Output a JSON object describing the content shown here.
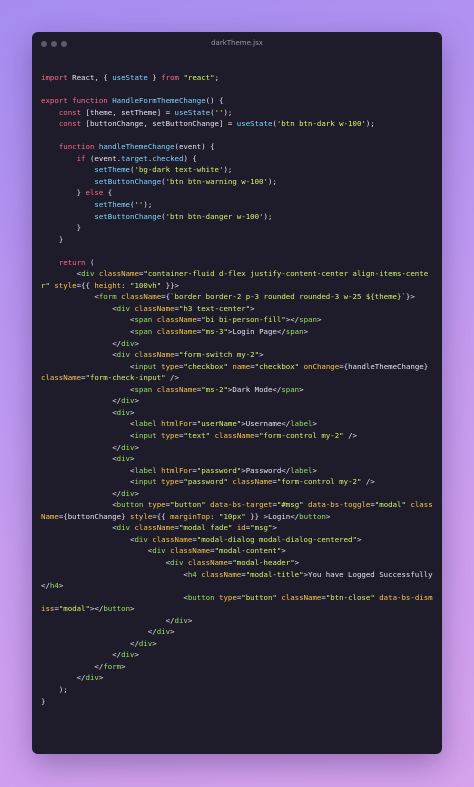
{
  "window": {
    "title": "darkTheme.jsx"
  },
  "colors": {
    "keyword": "#ff6b88",
    "function": "#7fd7ff",
    "tag": "#9de05d",
    "attribute": "#f6c94c",
    "string": "#d4f46a",
    "text": "#e6e3ee"
  },
  "code_lines": [
    [
      [
        "kw",
        "import"
      ],
      [
        "p",
        " React, { "
      ],
      [
        "fn",
        "useState"
      ],
      [
        "p",
        " } "
      ],
      [
        "kw",
        "from"
      ],
      [
        "p",
        " "
      ],
      [
        "str",
        "\"react\""
      ],
      [
        "p",
        ";"
      ]
    ],
    [],
    [
      [
        "kw",
        "export function"
      ],
      [
        "p",
        " "
      ],
      [
        "fn",
        "HandleFormThemeChange"
      ],
      [
        "p",
        "() {"
      ]
    ],
    [
      [
        "p",
        "    "
      ],
      [
        "kw",
        "const"
      ],
      [
        "p",
        " [theme, setTheme] = "
      ],
      [
        "fn",
        "useState"
      ],
      [
        "p",
        "("
      ],
      [
        "str",
        "''"
      ],
      [
        "p",
        ");"
      ]
    ],
    [
      [
        "p",
        "    "
      ],
      [
        "kw",
        "const"
      ],
      [
        "p",
        " [buttonChange, setButtonChange] = "
      ],
      [
        "fn",
        "useState"
      ],
      [
        "p",
        "("
      ],
      [
        "str",
        "'btn btn-dark w-100'"
      ],
      [
        "p",
        ");"
      ]
    ],
    [],
    [
      [
        "p",
        "    "
      ],
      [
        "kw",
        "function"
      ],
      [
        "p",
        " "
      ],
      [
        "fn",
        "handleThemeChange"
      ],
      [
        "p",
        "(event) {"
      ]
    ],
    [
      [
        "p",
        "        "
      ],
      [
        "kw",
        "if"
      ],
      [
        "p",
        " (event."
      ],
      [
        "fn",
        "target"
      ],
      [
        "p",
        "."
      ],
      [
        "fn",
        "checked"
      ],
      [
        "p",
        ") {"
      ]
    ],
    [
      [
        "p",
        "            "
      ],
      [
        "fn",
        "setTheme"
      ],
      [
        "p",
        "("
      ],
      [
        "str",
        "'bg-dark text-white'"
      ],
      [
        "p",
        ");"
      ]
    ],
    [
      [
        "p",
        "            "
      ],
      [
        "fn",
        "setButtonChange"
      ],
      [
        "p",
        "("
      ],
      [
        "str",
        "'btn btn-warning w-100'"
      ],
      [
        "p",
        ");"
      ]
    ],
    [
      [
        "p",
        "        } "
      ],
      [
        "kw",
        "else"
      ],
      [
        "p",
        " {"
      ]
    ],
    [
      [
        "p",
        "            "
      ],
      [
        "fn",
        "setTheme"
      ],
      [
        "p",
        "("
      ],
      [
        "str",
        "''"
      ],
      [
        "p",
        ");"
      ]
    ],
    [
      [
        "p",
        "            "
      ],
      [
        "fn",
        "setButtonChange"
      ],
      [
        "p",
        "("
      ],
      [
        "str",
        "'btn btn-danger w-100'"
      ],
      [
        "p",
        ");"
      ]
    ],
    [
      [
        "p",
        "        }"
      ]
    ],
    [
      [
        "p",
        "    }"
      ]
    ],
    [],
    [
      [
        "p",
        "    "
      ],
      [
        "kw",
        "return"
      ],
      [
        "p",
        " ("
      ]
    ],
    [
      [
        "p",
        "        <"
      ],
      [
        "tag",
        "div"
      ],
      [
        "p",
        " "
      ],
      [
        "attr",
        "className"
      ],
      [
        "p",
        "="
      ],
      [
        "str",
        "\"container-fluid d-flex justify-content-center align-items-center\""
      ],
      [
        "p",
        " "
      ],
      [
        "attr",
        "style"
      ],
      [
        "p",
        "={{ "
      ],
      [
        "attr",
        "height"
      ],
      [
        "p",
        ": "
      ],
      [
        "str",
        "\"100vh\""
      ],
      [
        "p",
        " }}>"
      ]
    ],
    [
      [
        "p",
        "            <"
      ],
      [
        "tag",
        "form"
      ],
      [
        "p",
        " "
      ],
      [
        "attr",
        "className"
      ],
      [
        "p",
        "={"
      ],
      [
        "str",
        "`border border-2 p-3 rounded rounded-3 w-25 ${theme}`"
      ],
      [
        "p",
        "}>"
      ]
    ],
    [
      [
        "p",
        "                <"
      ],
      [
        "tag",
        "div"
      ],
      [
        "p",
        " "
      ],
      [
        "attr",
        "className"
      ],
      [
        "p",
        "="
      ],
      [
        "str",
        "\"h3 text-center\""
      ],
      [
        "p",
        ">"
      ]
    ],
    [
      [
        "p",
        "                    <"
      ],
      [
        "tag",
        "span"
      ],
      [
        "p",
        " "
      ],
      [
        "attr",
        "className"
      ],
      [
        "p",
        "="
      ],
      [
        "str",
        "\"bi bi-person-fill\""
      ],
      [
        "p",
        "></"
      ],
      [
        "tag",
        "span"
      ],
      [
        "p",
        ">"
      ]
    ],
    [
      [
        "p",
        "                    <"
      ],
      [
        "tag",
        "span"
      ],
      [
        "p",
        " "
      ],
      [
        "attr",
        "className"
      ],
      [
        "p",
        "="
      ],
      [
        "str",
        "\"ms-3\""
      ],
      [
        "p",
        ">Login Page</"
      ],
      [
        "tag",
        "span"
      ],
      [
        "p",
        ">"
      ]
    ],
    [
      [
        "p",
        "                </"
      ],
      [
        "tag",
        "div"
      ],
      [
        "p",
        ">"
      ]
    ],
    [
      [
        "p",
        "                <"
      ],
      [
        "tag",
        "div"
      ],
      [
        "p",
        " "
      ],
      [
        "attr",
        "className"
      ],
      [
        "p",
        "="
      ],
      [
        "str",
        "\"form-switch my-2\""
      ],
      [
        "p",
        ">"
      ]
    ],
    [
      [
        "p",
        "                    <"
      ],
      [
        "tag",
        "input"
      ],
      [
        "p",
        " "
      ],
      [
        "attr",
        "type"
      ],
      [
        "p",
        "="
      ],
      [
        "str",
        "\"checkbox\""
      ],
      [
        "p",
        " "
      ],
      [
        "attr",
        "name"
      ],
      [
        "p",
        "="
      ],
      [
        "str",
        "\"checkbox\""
      ],
      [
        "p",
        " "
      ],
      [
        "attr",
        "onChange"
      ],
      [
        "p",
        "={handleThemeChange} "
      ],
      [
        "attr",
        "className"
      ],
      [
        "p",
        "="
      ],
      [
        "str",
        "\"form-check-input\""
      ],
      [
        "p",
        " />"
      ]
    ],
    [
      [
        "p",
        "                    <"
      ],
      [
        "tag",
        "span"
      ],
      [
        "p",
        " "
      ],
      [
        "attr",
        "className"
      ],
      [
        "p",
        "="
      ],
      [
        "str",
        "\"ms-2\""
      ],
      [
        "p",
        ">Dark Mode</"
      ],
      [
        "tag",
        "span"
      ],
      [
        "p",
        ">"
      ]
    ],
    [
      [
        "p",
        "                </"
      ],
      [
        "tag",
        "div"
      ],
      [
        "p",
        ">"
      ]
    ],
    [
      [
        "p",
        "                <"
      ],
      [
        "tag",
        "div"
      ],
      [
        "p",
        ">"
      ]
    ],
    [
      [
        "p",
        "                    <"
      ],
      [
        "tag",
        "label"
      ],
      [
        "p",
        " "
      ],
      [
        "attr",
        "htmlFor"
      ],
      [
        "p",
        "="
      ],
      [
        "str",
        "\"userName\""
      ],
      [
        "p",
        ">Username</"
      ],
      [
        "tag",
        "label"
      ],
      [
        "p",
        ">"
      ]
    ],
    [
      [
        "p",
        "                    <"
      ],
      [
        "tag",
        "input"
      ],
      [
        "p",
        " "
      ],
      [
        "attr",
        "type"
      ],
      [
        "p",
        "="
      ],
      [
        "str",
        "\"text\""
      ],
      [
        "p",
        " "
      ],
      [
        "attr",
        "className"
      ],
      [
        "p",
        "="
      ],
      [
        "str",
        "\"form-control my-2\""
      ],
      [
        "p",
        " />"
      ]
    ],
    [
      [
        "p",
        "                </"
      ],
      [
        "tag",
        "div"
      ],
      [
        "p",
        ">"
      ]
    ],
    [
      [
        "p",
        "                <"
      ],
      [
        "tag",
        "div"
      ],
      [
        "p",
        ">"
      ]
    ],
    [
      [
        "p",
        "                    <"
      ],
      [
        "tag",
        "label"
      ],
      [
        "p",
        " "
      ],
      [
        "attr",
        "htmlFor"
      ],
      [
        "p",
        "="
      ],
      [
        "str",
        "\"password\""
      ],
      [
        "p",
        ">Password</"
      ],
      [
        "tag",
        "label"
      ],
      [
        "p",
        ">"
      ]
    ],
    [
      [
        "p",
        "                    <"
      ],
      [
        "tag",
        "input"
      ],
      [
        "p",
        " "
      ],
      [
        "attr",
        "type"
      ],
      [
        "p",
        "="
      ],
      [
        "str",
        "\"password\""
      ],
      [
        "p",
        " "
      ],
      [
        "attr",
        "className"
      ],
      [
        "p",
        "="
      ],
      [
        "str",
        "\"form-control my-2\""
      ],
      [
        "p",
        " />"
      ]
    ],
    [
      [
        "p",
        "                </"
      ],
      [
        "tag",
        "div"
      ],
      [
        "p",
        ">"
      ]
    ],
    [
      [
        "p",
        "                <"
      ],
      [
        "tag",
        "button"
      ],
      [
        "p",
        " "
      ],
      [
        "attr",
        "type"
      ],
      [
        "p",
        "="
      ],
      [
        "str",
        "\"button\""
      ],
      [
        "p",
        " "
      ],
      [
        "attr",
        "data-bs-target"
      ],
      [
        "p",
        "="
      ],
      [
        "str",
        "\"#msg\""
      ],
      [
        "p",
        " "
      ],
      [
        "attr",
        "data-bs-toggle"
      ],
      [
        "p",
        "="
      ],
      [
        "str",
        "\"modal\""
      ],
      [
        "p",
        " "
      ],
      [
        "attr",
        "className"
      ],
      [
        "p",
        "={buttonChange} "
      ],
      [
        "attr",
        "style"
      ],
      [
        "p",
        "={{ "
      ],
      [
        "attr",
        "marginTop"
      ],
      [
        "p",
        ": "
      ],
      [
        "str",
        "\"10px\""
      ],
      [
        "p",
        " }} >Login</"
      ],
      [
        "tag",
        "button"
      ],
      [
        "p",
        ">"
      ]
    ],
    [
      [
        "p",
        "                <"
      ],
      [
        "tag",
        "div"
      ],
      [
        "p",
        " "
      ],
      [
        "attr",
        "className"
      ],
      [
        "p",
        "="
      ],
      [
        "str",
        "\"modal fade\""
      ],
      [
        "p",
        " "
      ],
      [
        "attr",
        "id"
      ],
      [
        "p",
        "="
      ],
      [
        "str",
        "\"msg\""
      ],
      [
        "p",
        ">"
      ]
    ],
    [
      [
        "p",
        "                    <"
      ],
      [
        "tag",
        "div"
      ],
      [
        "p",
        " "
      ],
      [
        "attr",
        "className"
      ],
      [
        "p",
        "="
      ],
      [
        "str",
        "\"modal-dialog modal-dialog-centered\""
      ],
      [
        "p",
        ">"
      ]
    ],
    [
      [
        "p",
        "                        <"
      ],
      [
        "tag",
        "div"
      ],
      [
        "p",
        " "
      ],
      [
        "attr",
        "className"
      ],
      [
        "p",
        "="
      ],
      [
        "str",
        "\"modal-content\""
      ],
      [
        "p",
        ">"
      ]
    ],
    [
      [
        "p",
        "                            <"
      ],
      [
        "tag",
        "div"
      ],
      [
        "p",
        " "
      ],
      [
        "attr",
        "className"
      ],
      [
        "p",
        "="
      ],
      [
        "str",
        "\"modal-header\""
      ],
      [
        "p",
        ">"
      ]
    ],
    [
      [
        "p",
        "                                <"
      ],
      [
        "tag",
        "h4"
      ],
      [
        "p",
        " "
      ],
      [
        "attr",
        "className"
      ],
      [
        "p",
        "="
      ],
      [
        "str",
        "\"modal-title\""
      ],
      [
        "p",
        ">You have Logged Successfully</"
      ],
      [
        "tag",
        "h4"
      ],
      [
        "p",
        ">"
      ]
    ],
    [
      [
        "p",
        "                                <"
      ],
      [
        "tag",
        "button"
      ],
      [
        "p",
        " "
      ],
      [
        "attr",
        "type"
      ],
      [
        "p",
        "="
      ],
      [
        "str",
        "\"button\""
      ],
      [
        "p",
        " "
      ],
      [
        "attr",
        "className"
      ],
      [
        "p",
        "="
      ],
      [
        "str",
        "\"btn-close\""
      ],
      [
        "p",
        " "
      ],
      [
        "attr",
        "data-bs-dismiss"
      ],
      [
        "p",
        "="
      ],
      [
        "str",
        "\"modal\""
      ],
      [
        "p",
        "></"
      ],
      [
        "tag",
        "button"
      ],
      [
        "p",
        ">"
      ]
    ],
    [
      [
        "p",
        "                            </"
      ],
      [
        "tag",
        "div"
      ],
      [
        "p",
        ">"
      ]
    ],
    [
      [
        "p",
        "                        </"
      ],
      [
        "tag",
        "div"
      ],
      [
        "p",
        ">"
      ]
    ],
    [
      [
        "p",
        "                    </"
      ],
      [
        "tag",
        "div"
      ],
      [
        "p",
        ">"
      ]
    ],
    [
      [
        "p",
        "                </"
      ],
      [
        "tag",
        "div"
      ],
      [
        "p",
        ">"
      ]
    ],
    [
      [
        "p",
        "            </"
      ],
      [
        "tag",
        "form"
      ],
      [
        "p",
        ">"
      ]
    ],
    [
      [
        "p",
        "        </"
      ],
      [
        "tag",
        "div"
      ],
      [
        "p",
        ">"
      ]
    ],
    [
      [
        "p",
        "    );"
      ]
    ],
    [
      [
        "p",
        "}"
      ]
    ]
  ]
}
